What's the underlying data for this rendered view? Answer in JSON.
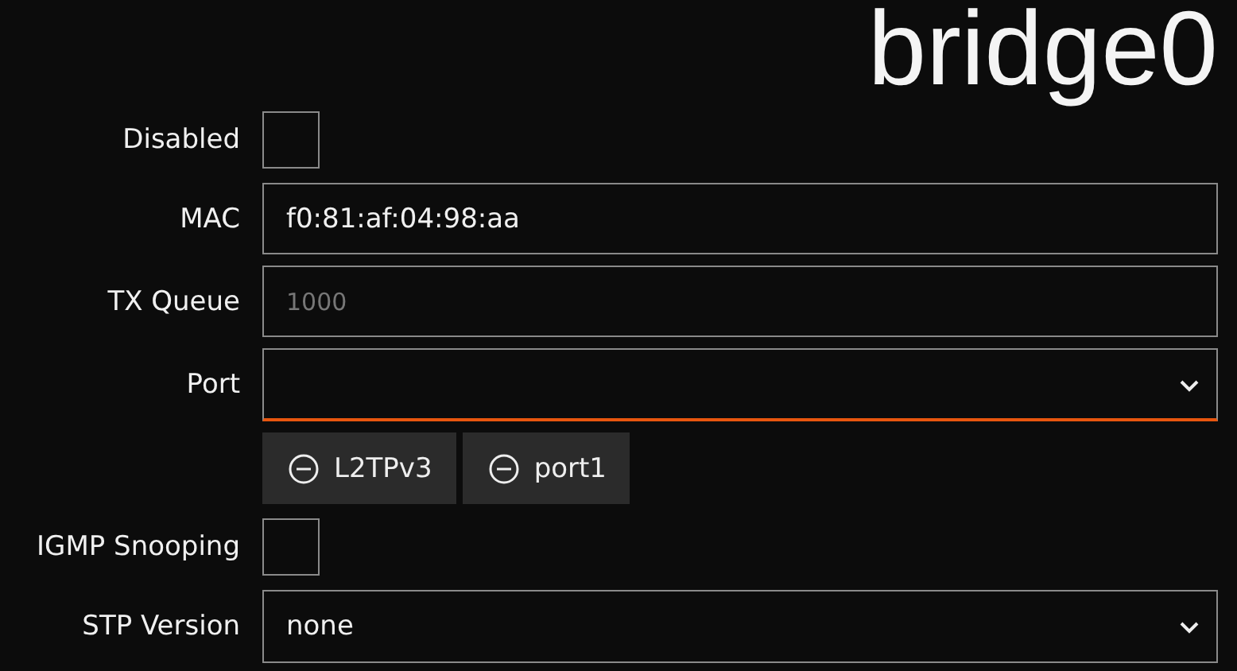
{
  "title": "bridge0",
  "fields": [
    {
      "kind": "checkbox",
      "label": "Disabled",
      "checked": false
    },
    {
      "kind": "text",
      "label": "MAC",
      "value": "f0:81:af:04:98:aa"
    },
    {
      "kind": "text",
      "label": "TX Queue",
      "placeholder": "1000"
    },
    {
      "kind": "select",
      "label": "Port",
      "focused": true
    },
    {
      "kind": "chips",
      "chips": [
        "L2TPv3",
        "port1"
      ]
    },
    {
      "kind": "checkbox",
      "label": "IGMP Snooping",
      "checked": false
    },
    {
      "kind": "select",
      "label": "STP Version",
      "value": "none",
      "focused": false
    }
  ]
}
